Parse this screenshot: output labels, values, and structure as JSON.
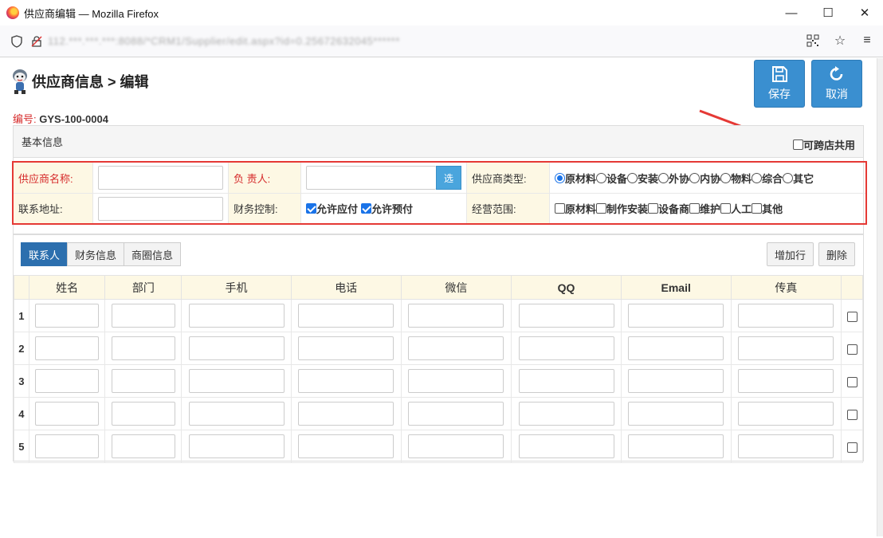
{
  "window": {
    "title": "供应商编辑 — Mozilla Firefox",
    "url": "112.***.***.***:8088/*CRM1/Supplier/edit.aspx?id=0.25672632045******",
    "minimize": "—",
    "maximize": "☐",
    "close": "✕"
  },
  "header": {
    "title": "供应商信息 > 编辑",
    "save_label": "保存",
    "cancel_label": "取消"
  },
  "code": {
    "label": "编号:",
    "value": "GYS-100-0004"
  },
  "basic": {
    "title": "基本信息",
    "share_label": "可跨店共用",
    "name_label": "供应商名称:",
    "owner_label": "负 责人:",
    "select_label": "选",
    "type_label": "供应商类型:",
    "types": [
      "原材料",
      "设备",
      "安装",
      "外协",
      "内协",
      "物料",
      "综合",
      "其它"
    ],
    "address_label": "联系地址:",
    "finance_label": "财务控制:",
    "finance_opts": [
      "允许应付",
      "允许预付"
    ],
    "scope_label": "经营范围:",
    "scopes": [
      "原材料",
      "制作安装",
      "设备商",
      "维护",
      "人工",
      "其他"
    ]
  },
  "grid": {
    "tabs": [
      "联系人",
      "财务信息",
      "商圈信息"
    ],
    "add_row_label": "增加行",
    "delete_label": "删除",
    "columns": [
      "姓名",
      "部门",
      "手机",
      "电话",
      "微信",
      "QQ",
      "Email",
      "传真"
    ],
    "rows": [
      "1",
      "2",
      "3",
      "4",
      "5"
    ]
  }
}
